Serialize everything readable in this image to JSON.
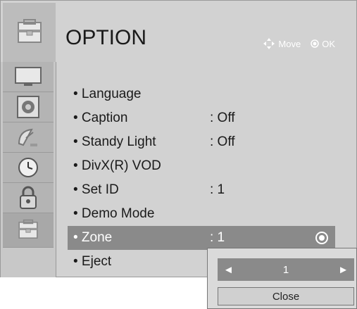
{
  "header": {
    "title": "OPTION",
    "move_hint": "Move",
    "ok_hint": "OK"
  },
  "sidebar": {
    "tabs": [
      {
        "icon": "tv-screen-icon"
      },
      {
        "icon": "speaker-icon"
      },
      {
        "icon": "satellite-dish-icon"
      },
      {
        "icon": "clock-icon"
      },
      {
        "icon": "lock-icon"
      },
      {
        "icon": "toolbox-icon",
        "active": true
      }
    ]
  },
  "menu": {
    "items": [
      {
        "label": "• Language",
        "value": ""
      },
      {
        "label": "• Caption",
        "value": ": Off"
      },
      {
        "label": "• Standy Light",
        "value": ": Off"
      },
      {
        "label": "• DivX(R) VOD",
        "value": ""
      },
      {
        "label": "• Set ID",
        "value": ": 1"
      },
      {
        "label": "• Demo Mode",
        "value": ""
      },
      {
        "label": "• Zone",
        "value": ": 1",
        "selected": true
      },
      {
        "label": "• Eject",
        "value": ""
      }
    ]
  },
  "popup": {
    "stepper_value": "1",
    "left_arrow": "◄",
    "right_arrow": "►",
    "close_label": "Close"
  },
  "colors": {
    "selected_row": "#8a8a8a",
    "panel": "#d2d2d2"
  }
}
